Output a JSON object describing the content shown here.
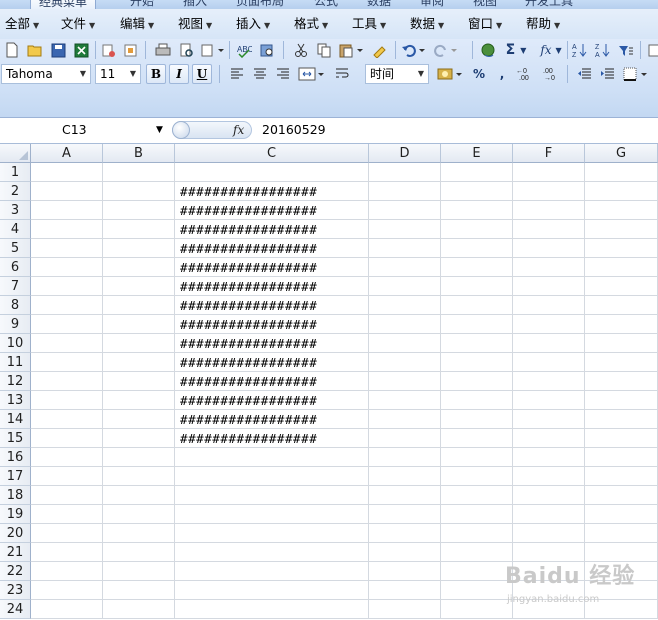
{
  "ribbon_tabs": [
    "经典菜单",
    "开始",
    "插入",
    "页面布局",
    "公式",
    "数据",
    "审阅",
    "视图",
    "开发工具"
  ],
  "menu": [
    "全部",
    "文件",
    "编辑",
    "视图",
    "插入",
    "格式",
    "工具",
    "数据",
    "窗口",
    "帮助"
  ],
  "font_combo": {
    "value": "Tahoma"
  },
  "size_combo": {
    "value": "11"
  },
  "number_format_combo": {
    "value": "时间"
  },
  "format_buttons": {
    "bold": "B",
    "italic": "I",
    "underline": "U"
  },
  "formula_bar": {
    "name_box": "C13",
    "fx_label": "fx",
    "content": "20160529"
  },
  "columns": [
    "A",
    "B",
    "C",
    "D",
    "E",
    "F",
    "G"
  ],
  "rows": [
    "1",
    "2",
    "3",
    "4",
    "5",
    "6",
    "7",
    "8",
    "9",
    "10",
    "11",
    "12",
    "13",
    "14",
    "15",
    "16",
    "17",
    "18",
    "19",
    "20",
    "21",
    "22",
    "23",
    "24"
  ],
  "cells_c": [
    "",
    "#################",
    "#################",
    "#################",
    "#################",
    "#################",
    "#################",
    "#################",
    "#################",
    "#################",
    "#################",
    "#################",
    "#################",
    "#################",
    "#################",
    "",
    "",
    "",
    "",
    "",
    "",
    "",
    "",
    ""
  ],
  "watermark": {
    "brand": "Baidu 经验",
    "sub": "jingyan.baidu.com"
  },
  "colors": {
    "ribbon": "#d6e5f7",
    "header": "#e3e9f2",
    "gridline": "#d4d9e0",
    "accent": "#1d3d73"
  },
  "icons": [
    "new-file-icon",
    "open-folder-icon",
    "save-icon",
    "excel-icon",
    "permission-icon",
    "preview-icon",
    "print-icon",
    "print-preview-icon",
    "research-icon",
    "spelling-icon",
    "cut-icon",
    "copy-icon",
    "paste-icon",
    "format-painter-icon",
    "undo-icon",
    "redo-icon",
    "hyperlink-icon",
    "autosum-icon",
    "function-icon",
    "sort-asc-icon",
    "sort-desc-icon",
    "filter-icon",
    "align-left-icon",
    "align-center-icon",
    "align-right-icon",
    "merge-center-icon",
    "wrap-text-icon",
    "currency-icon",
    "percent-icon",
    "comma-icon",
    "increase-decimal-icon",
    "decrease-decimal-icon",
    "decrease-indent-icon",
    "increase-indent-icon",
    "borders-icon"
  ]
}
